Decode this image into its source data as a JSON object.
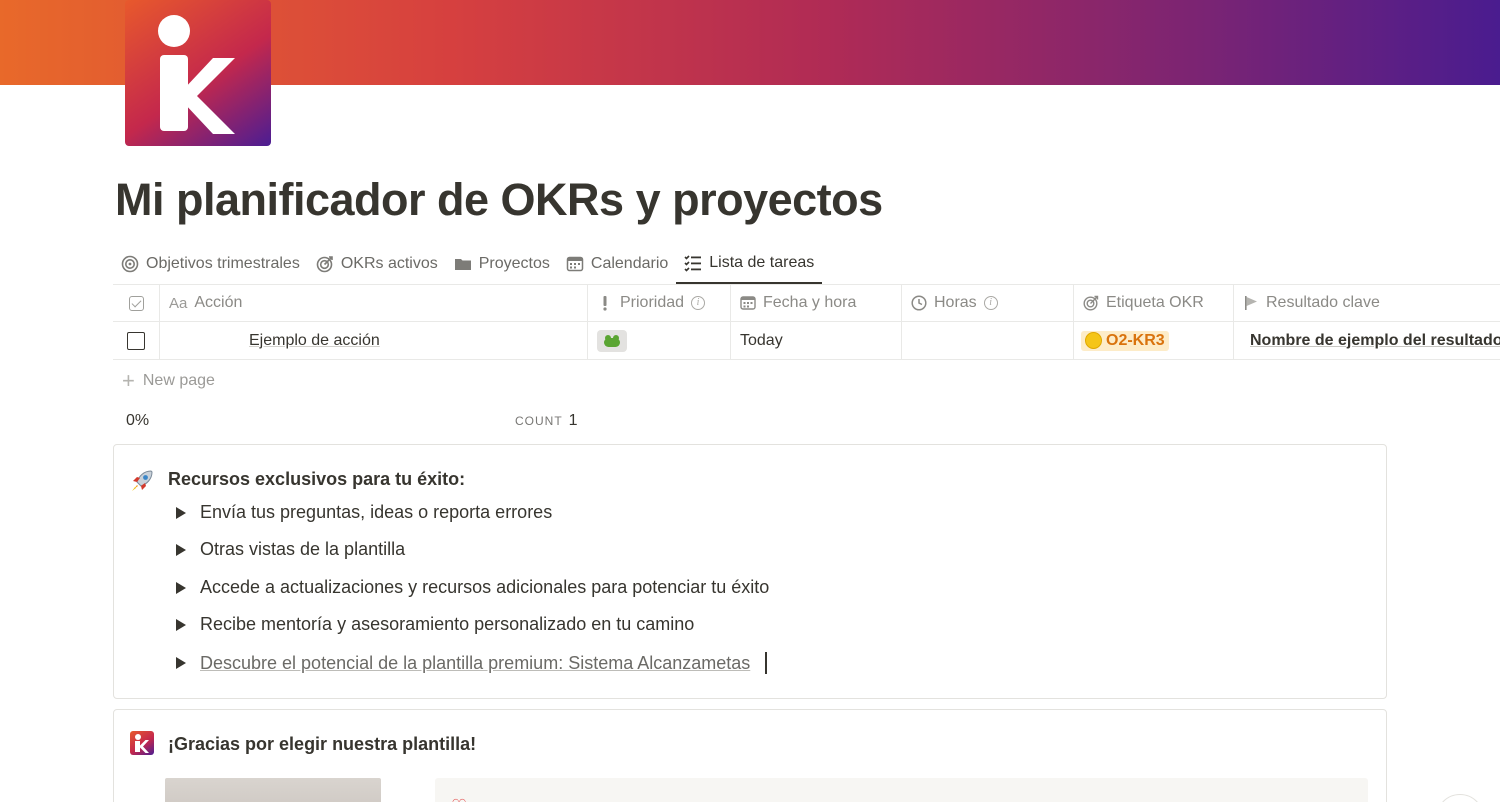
{
  "page": {
    "title": "Mi planificador de OKRs y proyectos",
    "cover_colors": [
      "#e8692a",
      "#d6403f",
      "#b02b55",
      "#7b2473",
      "#4a1c8f"
    ],
    "logo_icon": "ik-logo"
  },
  "tabs": [
    {
      "label": "Objetivos trimestrales",
      "icon": "target-icon",
      "active": false
    },
    {
      "label": "OKRs activos",
      "icon": "target-arrow-icon",
      "active": false
    },
    {
      "label": "Proyectos",
      "icon": "folder-icon",
      "active": false
    },
    {
      "label": "Calendario",
      "icon": "calendar-icon",
      "active": false
    },
    {
      "label": "Lista de tareas",
      "icon": "checklist-icon",
      "active": true
    }
  ],
  "table": {
    "headers": {
      "accion_prefix": "Aa",
      "accion": "Acción",
      "prioridad": "Prioridad",
      "fecha": "Fecha y hora",
      "horas": "Horas",
      "etiqueta": "Etiqueta OKR",
      "resultado": "Resultado clave"
    },
    "rows": [
      {
        "accion": "Ejemplo de acción",
        "prioridad": "frog-emoji",
        "fecha": "Today",
        "horas": "",
        "etiqueta": "O2-KR3",
        "etiqueta_color": "#d9730d",
        "resultado": "Nombre de ejemplo del resultado clave"
      }
    ],
    "new_page_label": "New page",
    "summary": {
      "percent": "0%",
      "count_label": "COUNT",
      "count_value": "1"
    }
  },
  "resources": {
    "icon": "rocket-icon",
    "title": "Recursos exclusivos para tu éxito:",
    "items": [
      "Envía tus preguntas, ideas o reporta errores",
      "Otras vistas de la plantilla",
      "Accede a actualizaciones y recursos adicionales para potenciar tu éxito",
      "Recibe mentoría y asesoramiento personalizado en tu camino",
      "Descubre el potencial de la plantilla premium: Sistema Alcanzametas"
    ]
  },
  "thanks": {
    "icon": "ik-logo-mini",
    "title": "¡Gracias por elegir nuestra plantilla!"
  }
}
